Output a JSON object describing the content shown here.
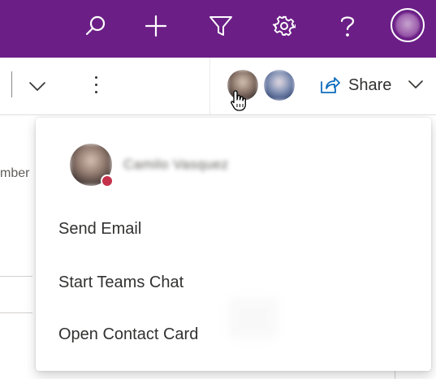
{
  "header": {
    "background": "#6b1f86",
    "icons": [
      {
        "name": "search-icon"
      },
      {
        "name": "add-icon"
      },
      {
        "name": "filter-icon"
      },
      {
        "name": "settings-icon"
      },
      {
        "name": "help-icon"
      },
      {
        "name": "user-avatar"
      }
    ]
  },
  "command_bar": {
    "share_label": "Share",
    "more_icon": "more-vertical-icon",
    "chevron_icon": "chevron-down-icon"
  },
  "background": {
    "partial_text": "mber"
  },
  "contact_popup": {
    "name": "Camilo Vasquez",
    "presence_color": "#c4314b",
    "items": [
      {
        "label": "Send Email"
      },
      {
        "label": "Start Teams Chat"
      },
      {
        "label": "Open Contact Card"
      }
    ]
  }
}
